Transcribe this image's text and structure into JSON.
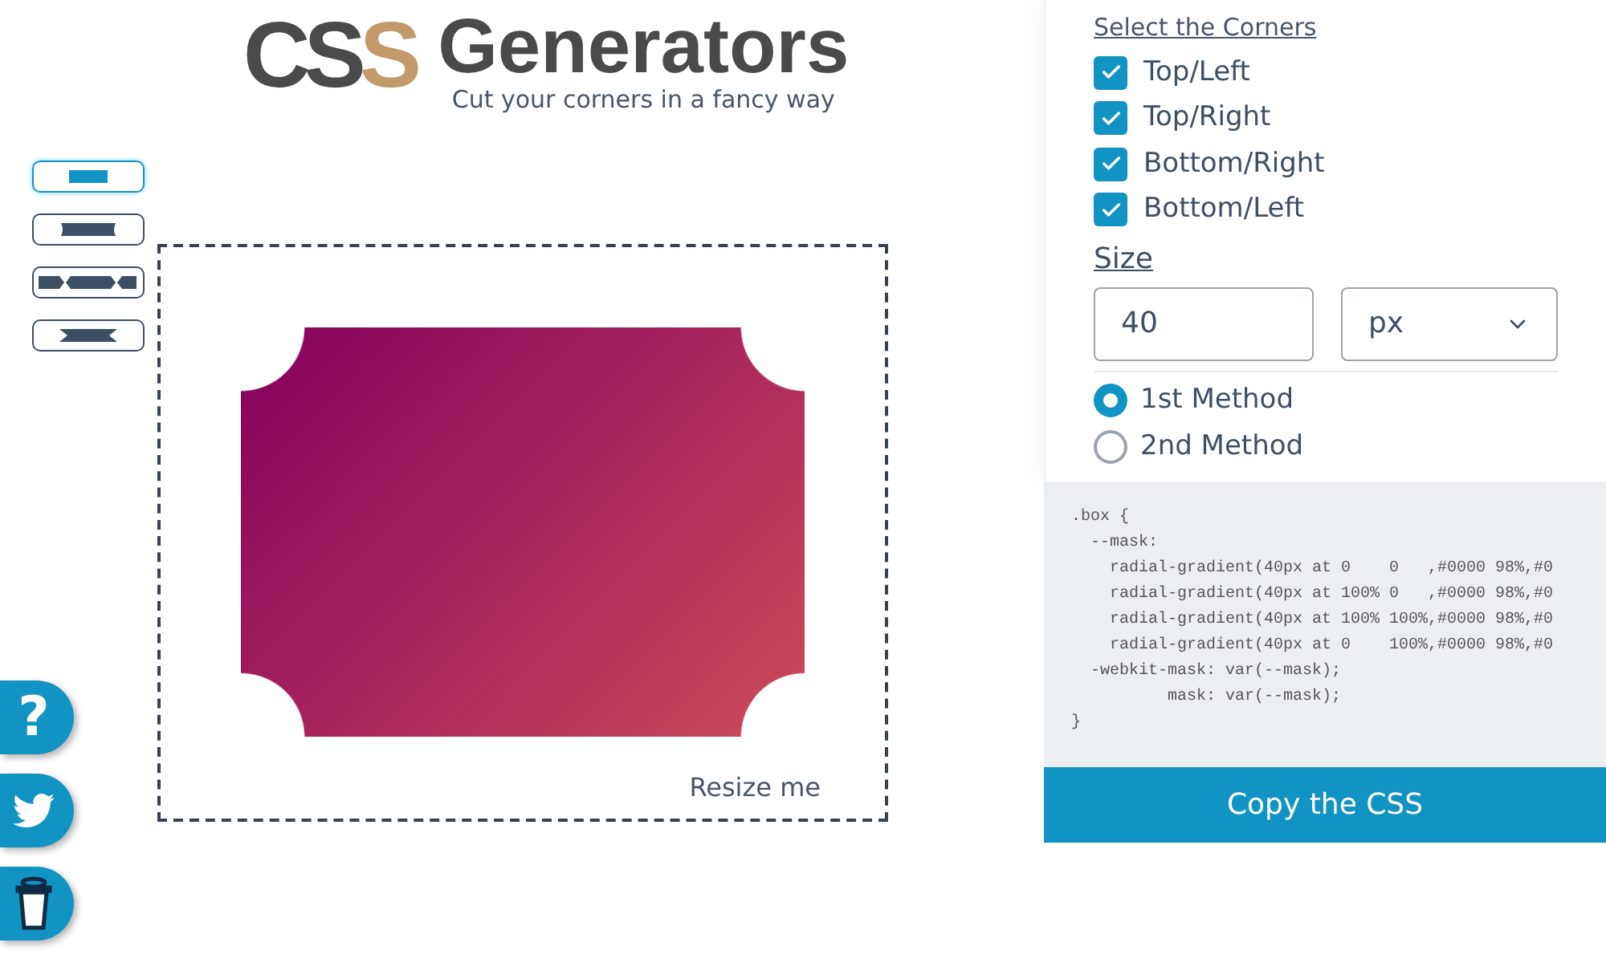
{
  "logo": {
    "mark_main": "CS",
    "mark_accent": "S",
    "title": "Generators"
  },
  "tagline": "Cut your corners in a fancy way",
  "shape_options": [
    {
      "kind": "plain",
      "selected": true
    },
    {
      "kind": "scooped",
      "selected": false
    },
    {
      "kind": "notched",
      "selected": false
    },
    {
      "kind": "bowtie",
      "selected": false
    }
  ],
  "preview": {
    "resize_hint": "Resize me"
  },
  "floating_buttons": [
    {
      "kind": "help",
      "label": "?"
    },
    {
      "kind": "twitter"
    },
    {
      "kind": "coffee"
    }
  ],
  "settings": {
    "corners_heading": "Select the Corners",
    "corners": [
      {
        "label": "Top/Left",
        "checked": true
      },
      {
        "label": "Top/Right",
        "checked": true
      },
      {
        "label": "Bottom/Right",
        "checked": true
      },
      {
        "label": "Bottom/Left",
        "checked": true
      }
    ],
    "size_label": "Size",
    "size_value": "40",
    "unit": "px",
    "methods": [
      {
        "label": "1st Method",
        "selected": true
      },
      {
        "label": "2nd Method",
        "selected": false
      }
    ]
  },
  "code_lines": [
    ".box {",
    "  --mask:",
    "    radial-gradient(40px at 0    0   ,#0000 98%,#0",
    "    radial-gradient(40px at 100% 0   ,#0000 98%,#0",
    "    radial-gradient(40px at 100% 100%,#0000 98%,#0",
    "    radial-gradient(40px at 0    100%,#0000 98%,#0",
    "  -webkit-mask: var(--mask);",
    "          mask: var(--mask);",
    "}"
  ],
  "copy_button": "Copy the CSS"
}
